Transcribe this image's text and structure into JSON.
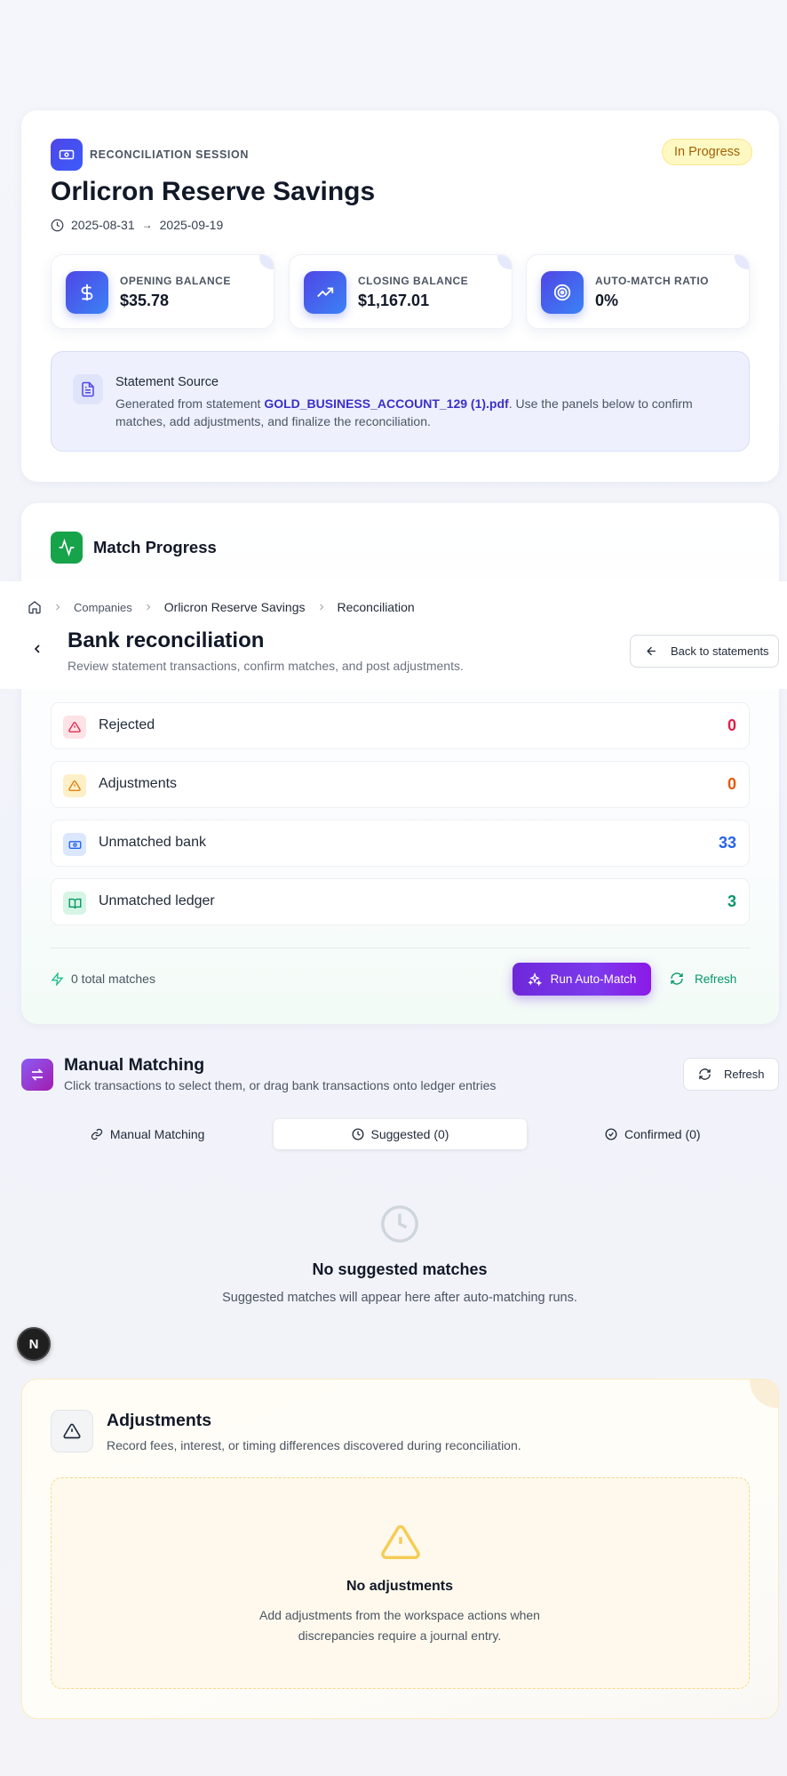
{
  "session": {
    "label": "RECONCILIATION SESSION",
    "status": "In Progress",
    "title": "Orlicron Reserve Savings",
    "date_start": "2025-08-31",
    "date_arrow": "→",
    "date_end": "2025-09-19"
  },
  "stats": [
    {
      "label": "OPENING BALANCE",
      "value": "$35.78",
      "icon": "dollar-icon"
    },
    {
      "label": "CLOSING BALANCE",
      "value": "$1,167.01",
      "icon": "trending-up-icon"
    },
    {
      "label": "AUTO-MATCH RATIO",
      "value": "0%",
      "icon": "target-icon"
    }
  ],
  "source": {
    "title": "Statement Source",
    "prefix": "Generated from statement ",
    "filename": "GOLD_BUSINESS_ACCOUNT_129 (1).pdf",
    "suffix": ". Use the panels below to confirm matches, add adjustments, and finalize the reconciliation."
  },
  "progress": {
    "title": "Match Progress",
    "rows": [
      {
        "label": "Rejected",
        "count": "0",
        "color": "#e11d48",
        "icon": "alert-triangle-icon"
      },
      {
        "label": "Adjustments",
        "count": "0",
        "color": "#ea580c",
        "icon": "warning-icon"
      },
      {
        "label": "Unmatched bank",
        "count": "33",
        "color": "#2563eb",
        "icon": "banknote-icon"
      },
      {
        "label": "Unmatched ledger",
        "count": "3",
        "color": "#059669",
        "icon": "book-open-icon"
      }
    ],
    "total_matches": "0 total matches",
    "run_button": "Run Auto-Match",
    "refresh": "Refresh"
  },
  "header": {
    "breadcrumb": [
      "Companies",
      "Orlicron Reserve Savings",
      "Reconciliation"
    ],
    "title": "Bank reconciliation",
    "subtitle": "Review statement transactions, confirm matches, and post adjustments.",
    "back_button": "Back to statements"
  },
  "manual": {
    "title": "Manual Matching",
    "subtitle": "Click transactions to select them, or drag bank transactions onto ledger entries",
    "refresh": "Refresh",
    "tabs": [
      {
        "label": "Manual Matching",
        "icon": "link-icon"
      },
      {
        "label": "Suggested (0)",
        "icon": "clock-icon"
      },
      {
        "label": "Confirmed (0)",
        "icon": "check-circle-icon"
      }
    ],
    "empty_title": "No suggested matches",
    "empty_sub": "Suggested matches will appear here after auto-matching runs."
  },
  "badge": "N",
  "adjustments": {
    "title": "Adjustments",
    "subtitle": "Record fees, interest, or timing differences discovered during reconciliation.",
    "empty_title": "No adjustments",
    "empty_sub": "Add adjustments from the workspace actions when discrepancies require a journal entry."
  }
}
